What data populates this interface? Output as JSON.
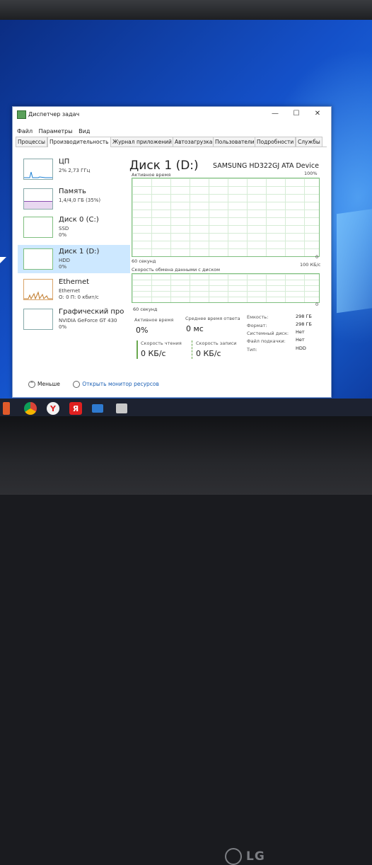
{
  "window": {
    "title": "Диспетчер задач",
    "minimize": "—",
    "maximize": "☐",
    "close": "✕"
  },
  "menu": [
    "Файл",
    "Параметры",
    "Вид"
  ],
  "tabs": [
    "Процессы",
    "Производительность",
    "Журнал приложений",
    "Автозагрузка",
    "Пользователи",
    "Подробности",
    "Службы"
  ],
  "sidebar": [
    {
      "name": "ЦП",
      "sub1": "2% 2,73 ГГц",
      "sub2": ""
    },
    {
      "name": "Память",
      "sub1": "1,4/4,0 ГБ (35%)",
      "sub2": ""
    },
    {
      "name": "Диск 0 (C:)",
      "sub1": "SSD",
      "sub2": "0%"
    },
    {
      "name": "Диск 1 (D:)",
      "sub1": "HDD",
      "sub2": "0%"
    },
    {
      "name": "Ethernet",
      "sub1": "Ethernet",
      "sub2": "О: 0 П: 0 кбит/с"
    },
    {
      "name": "Графический про",
      "sub1": "NVIDIA GeForce GT 430",
      "sub2": "0%"
    }
  ],
  "main": {
    "title": "Диск 1 (D:)",
    "model": "SAMSUNG HD322GJ ATA Device",
    "graph1_label": "Активное время",
    "graph1_max": "100%",
    "graph1_time": "60 секунд",
    "graph1_min": "0",
    "graph2_label": "Скорость обмена данными с диском",
    "graph2_max": "100 КБ/с",
    "graph2_time": "60 секунд",
    "graph2_min": "0"
  },
  "stats": {
    "active_label": "Активное время",
    "active_value": "0%",
    "resp_label": "Среднее время ответа",
    "resp_value": "0 мс",
    "read_label": "Скорость чтения",
    "read_value": "0 КБ/с",
    "write_label": "Скорость записи",
    "write_value": "0 КБ/с"
  },
  "info": [
    {
      "k": "Емкость:",
      "v": "298 ГБ"
    },
    {
      "k": "Формат:",
      "v": "298 ГБ"
    },
    {
      "k": "Системный диск:",
      "v": "Нет"
    },
    {
      "k": "Файл подкачки:",
      "v": "Нет"
    },
    {
      "k": "Тип:",
      "v": "HDD"
    }
  ],
  "footer": {
    "less": "Меньше",
    "resmon": "Открыть монитор ресурсов"
  },
  "monitor_brand": "LG",
  "colors": {
    "accent": "#cde8ff",
    "disk_line": "#6aa84f",
    "cpu_line": "#1a7fd4",
    "net_line": "#c07a2a",
    "read_bar": "#6aa84f"
  }
}
